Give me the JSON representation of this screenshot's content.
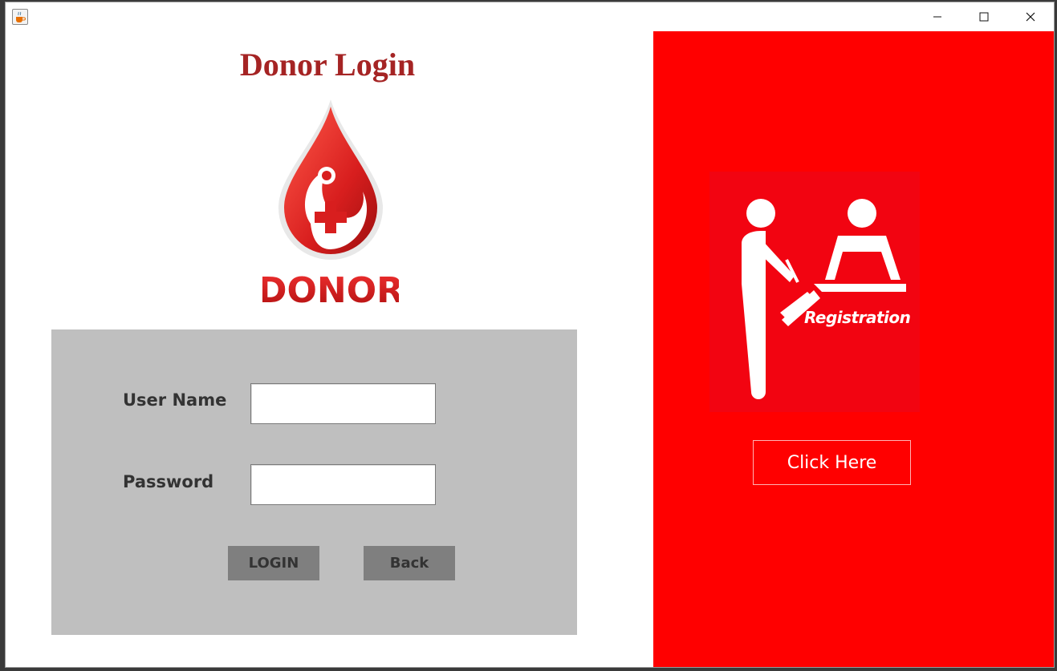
{
  "window": {
    "app_icon": "java-cup-icon",
    "controls": {
      "minimize_icon": "minimize-icon",
      "maximize_icon": "maximize-icon",
      "close_icon": "close-icon"
    }
  },
  "login": {
    "title": "Donor Login",
    "logo": {
      "icon": "blood-drop-cross-icon",
      "text": "DONOR"
    },
    "username_label": "User Name",
    "username_value": "",
    "password_label": "Password",
    "password_value": "",
    "login_button": "LOGIN",
    "back_button": "Back"
  },
  "registration": {
    "image_text": "Registration",
    "image_icon": "registration-desk-icon",
    "click_button": "Click Here"
  },
  "colors": {
    "title": "#a52424",
    "form_panel": "#bfbfbf",
    "button": "#7f7f7f",
    "right_panel": "#ff0000",
    "logo_red": "#d81e1e"
  }
}
